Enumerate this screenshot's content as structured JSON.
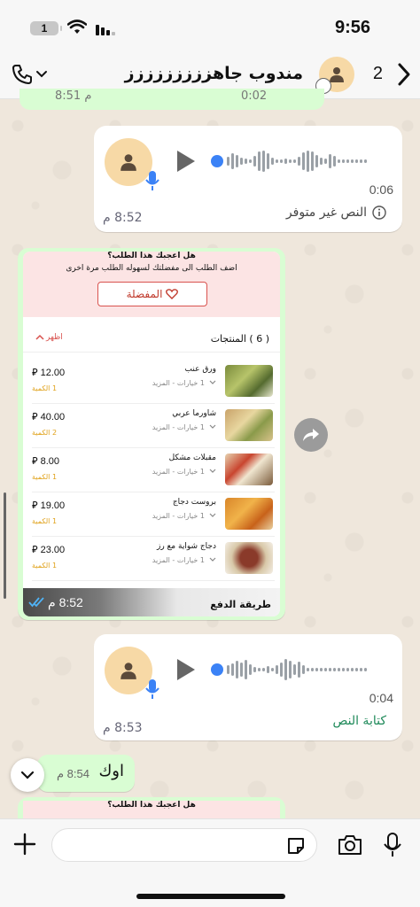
{
  "status_bar": {
    "battery": "1",
    "time": "9:56"
  },
  "header": {
    "contact_name": "مندوب جاهززززززززز",
    "unread_count": "2"
  },
  "top_partial": {
    "time": "8:51 م",
    "duration": "0:02"
  },
  "voice_messages": [
    {
      "duration": "0:06",
      "time": "8:52 م",
      "note": "النص غير متوفر"
    },
    {
      "duration": "0:04",
      "time": "8:53 م",
      "note": "كتابة النص",
      "note_color": "#1f8a5a"
    }
  ],
  "order_card": {
    "question": "هل اعجبك هذا الطلب؟",
    "subtitle": "اضف الطلب الى مفضلتك لسهوله الطلب مرة اخرى",
    "favorite_label": "المفضلة",
    "products_title": "( 6 ) المنتجات",
    "show_label": "اظهر",
    "products": [
      {
        "name": "ورق عنب",
        "options": "1 خيارات - المزيد",
        "price": "12.00",
        "qty": "1 الكمية"
      },
      {
        "name": "شاورما عربي",
        "options": "1 خيارات - المزيد",
        "price": "40.00",
        "qty": "2 الكمية"
      },
      {
        "name": "مقبلات مشكل",
        "options": "1 خيارات - المزيد",
        "price": "8.00",
        "qty": "1 الكمية"
      },
      {
        "name": "بروست دجاج",
        "options": "1 خيارات - المزيد",
        "price": "19.00",
        "qty": "1 الكمية"
      },
      {
        "name": "دجاج شواية مع رز",
        "options": "1 خيارات - المزيد",
        "price": "23.00",
        "qty": "1 الكمية"
      }
    ],
    "payment_label": "طريقة الدفع",
    "time": "8:52 م"
  },
  "ok_message": {
    "text": "اوك",
    "time": "8:54 م"
  },
  "next_card": {
    "question": "هل اعجبك هذا الطلب؟"
  },
  "colors": {
    "accent_green": "#d9fdd3",
    "fav_red": "#c0392b",
    "qty_orange": "#e0a21b",
    "blue_dot": "#3b82f6"
  },
  "icons": [
    "phone-icon",
    "chevron-down-icon",
    "back-chevron-icon",
    "play-icon",
    "mic-icon",
    "info-icon",
    "heart-icon",
    "forward-icon",
    "plus-icon",
    "sticker-icon",
    "camera-icon",
    "microphone-icon",
    "double-check-icon"
  ]
}
